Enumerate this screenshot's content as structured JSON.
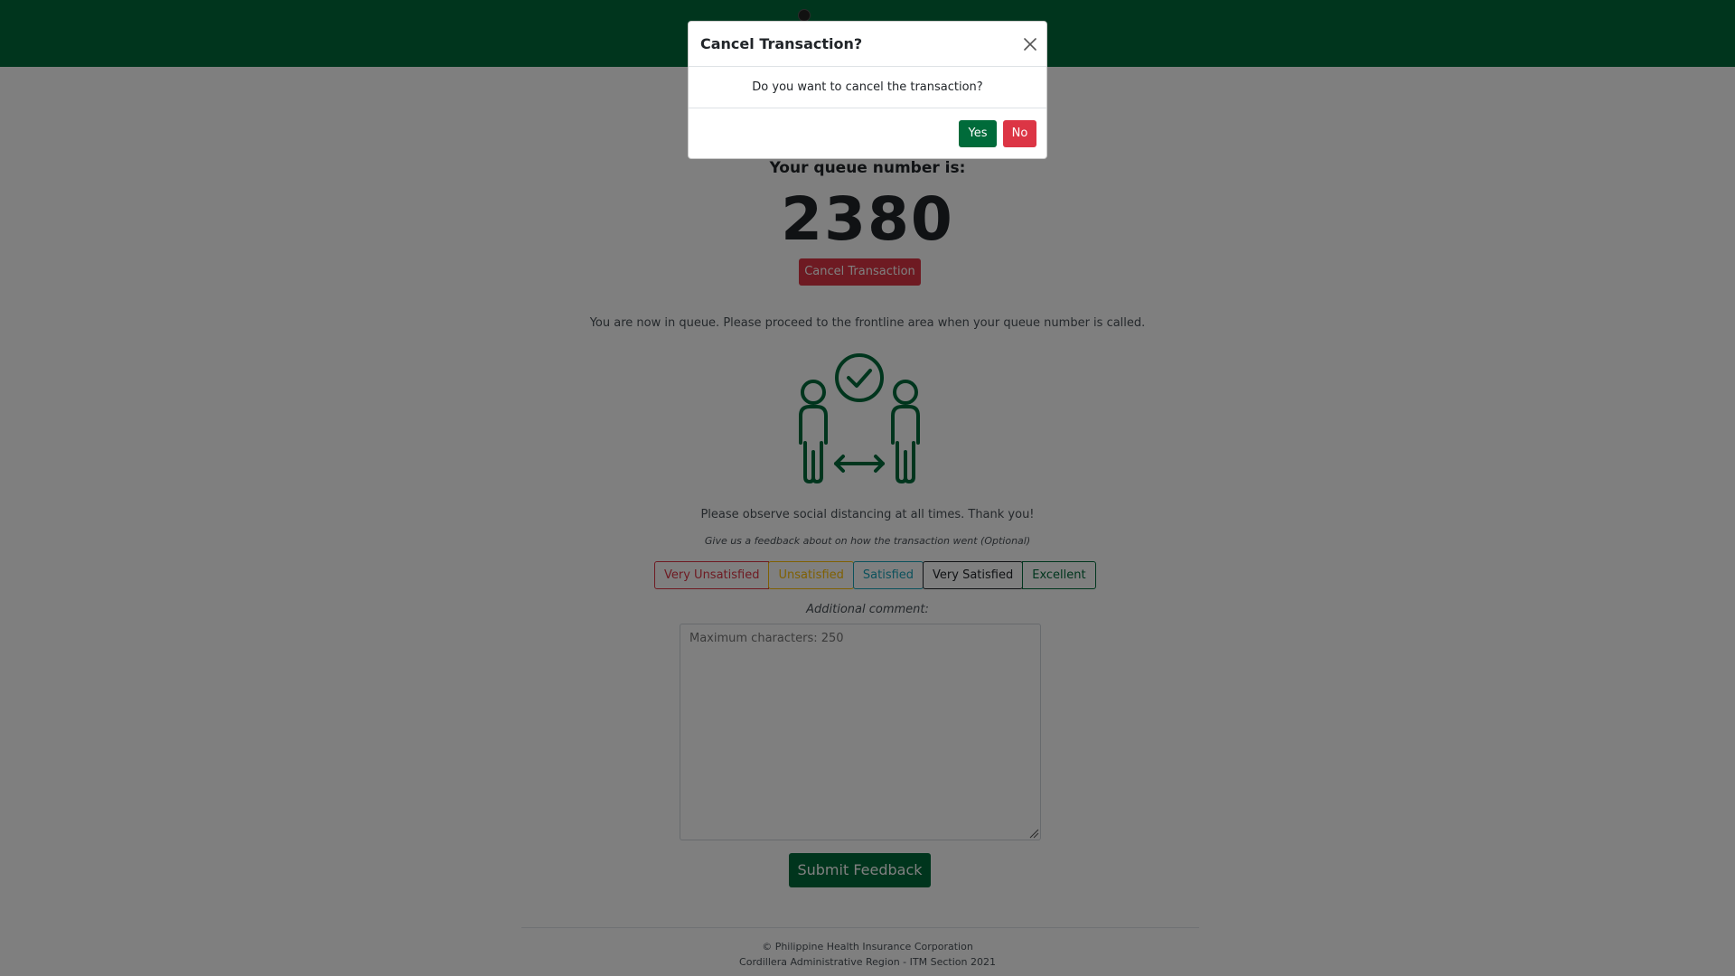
{
  "queue": {
    "label": "Your queue number is:",
    "number": "2380",
    "cancel_label": "Cancel Transaction",
    "info": "You are now in queue. Please proceed to the frontline area when your queue number is called."
  },
  "distancing": {
    "icon": "social-distancing-icon",
    "message": "Please observe social distancing at all times. Thank you!"
  },
  "feedback": {
    "prompt": "Give us a feedback about on how the transaction went (Optional)",
    "ratings": [
      {
        "label": "Very Unsatisfied",
        "color": "#dc3545"
      },
      {
        "label": "Unsatisfied",
        "color": "#ffc107"
      },
      {
        "label": "Satisfied",
        "color": "#17a2b8"
      },
      {
        "label": "Very Satisfied",
        "color": "#212529"
      },
      {
        "label": "Excellent",
        "color": "#006b3a"
      }
    ],
    "comment_label": "Additional comment:",
    "comment_placeholder": "Maximum characters: 250",
    "submit_label": "Submit Feedback"
  },
  "footer": {
    "line1": "© Philippine Health Insurance Corporation",
    "line2": "Cordillera Administrative Region - ITM Section 2021"
  },
  "modal": {
    "title": "Cancel Transaction?",
    "body": "Do you want to cancel the transaction?",
    "yes_label": "Yes",
    "no_label": "No"
  },
  "colors": {
    "brand_green": "#006b3a",
    "danger_red": "#dc3545"
  }
}
